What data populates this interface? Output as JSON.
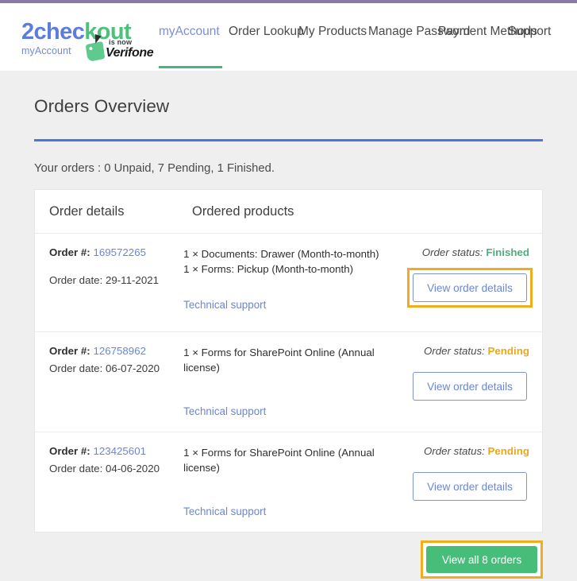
{
  "theme": {
    "top_strip": "#8a7aa8",
    "accent_blue": "#4a76dd",
    "link_blue": "#6a86d8",
    "green": "#46bd79",
    "pending_amber": "#e8a917",
    "highlight_orange": "#f0ad1e",
    "page_bg": "#efefef"
  },
  "header": {
    "logo": {
      "part_blue": "2chec",
      "part_green": "kout",
      "subtitle": "myAccount",
      "is_now": "is now",
      "brand": "Verifone"
    },
    "nav": [
      {
        "label": "myAccount",
        "active": true
      },
      {
        "label": "Order Lookup",
        "active": false
      },
      {
        "label": "My Products",
        "active": false
      },
      {
        "label": "Manage Password",
        "active": false
      },
      {
        "label": "Payment Methods",
        "active": false
      },
      {
        "label": "Support",
        "active": false
      }
    ]
  },
  "main": {
    "page_title": "Orders Overview",
    "summary": "Your orders : 0 Unpaid, 7 Pending, 1 Finished.",
    "table_headers": {
      "details": "Order details",
      "products": "Ordered products"
    },
    "order_label": "Order #:",
    "date_label": "Order date:",
    "status_label": "Order status:",
    "tech_support_label": "Technical support",
    "view_details_label": "View order details",
    "rows": [
      {
        "number": "169572265",
        "date": "29-11-2021",
        "products": [
          "1 × Documents: Drawer (Month-to-month)",
          "1 × Forms: Pickup (Month-to-month)"
        ],
        "status": "Finished",
        "status_kind": "finished",
        "highlighted": true
      },
      {
        "number": "126758962",
        "date": "06-07-2020",
        "products": [
          "1 × Forms for SharePoint Online (Annual license)"
        ],
        "status": "Pending",
        "status_kind": "pending",
        "highlighted": false
      },
      {
        "number": "123425601",
        "date": "04-06-2020",
        "products": [
          "1 × Forms for SharePoint Online (Annual license)"
        ],
        "status": "Pending",
        "status_kind": "pending",
        "highlighted": false
      }
    ],
    "view_all_label": "View all 8 orders"
  }
}
